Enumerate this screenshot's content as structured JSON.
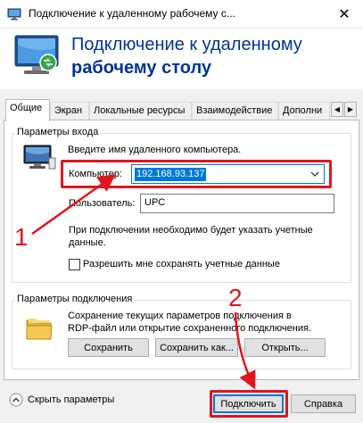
{
  "window": {
    "title": "Подключение к удаленному рабочему с...",
    "close_glyph": "✕"
  },
  "header": {
    "line1": "Подключение к удаленному",
    "line2": "рабочему столу"
  },
  "tabs": [
    {
      "label": "Общие",
      "active": true
    },
    {
      "label": "Экран",
      "active": false
    },
    {
      "label": "Локальные ресурсы",
      "active": false
    },
    {
      "label": "Взаимодействие",
      "active": false
    },
    {
      "label": "Дополни",
      "active": false
    }
  ],
  "tab_scroll": {
    "left": "◀",
    "right": "▶"
  },
  "login_group": {
    "label": "Параметры входа",
    "prompt": "Введите имя удаленного компьютера.",
    "computer_label": "Компьютер:",
    "computer_value": "192.168.93.137",
    "user_label": "Пользователь:",
    "user_value": "UPC",
    "info_line1": "При подключении необходимо будет указать учетные",
    "info_line2": "данные.",
    "save_creds_label": "Разрешить мне сохранять учетные данные",
    "save_creds_checked": false
  },
  "connection_group": {
    "label": "Параметры подключения",
    "desc_line1": "Сохранение текущих параметров подключения в",
    "desc_line2": "RDP-файл или открытие сохраненного подключения.",
    "save_button": "Сохранить",
    "save_as_button": "Сохранить как...",
    "open_button": "Открыть..."
  },
  "footer": {
    "hide_options": "Скрыть параметры",
    "connect_button": "Подключить",
    "help_button": "Справка"
  },
  "annotations": {
    "label1": "1",
    "label2": "2",
    "color": "#e0161d"
  }
}
